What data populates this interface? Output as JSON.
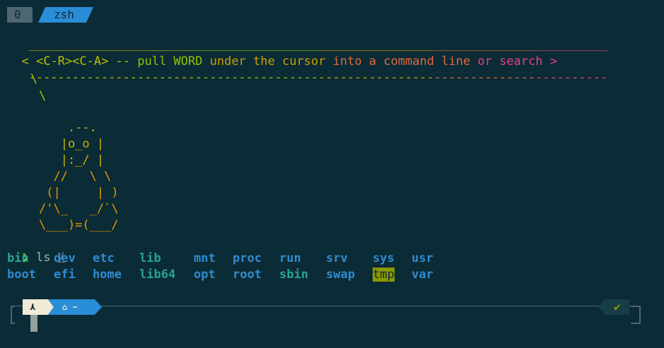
{
  "tmux": {
    "window_index": "0",
    "window_name": "zsh"
  },
  "cowsay": {
    "top_rule": "____________________________________________________________________________________",
    "message_parts": [
      {
        "text": "< <C-R><C-A> -- ",
        "color": "#b5c100"
      },
      {
        "text": "pull WORD ",
        "color": "#93c200"
      },
      {
        "text": "under the ",
        "color": "#c8a000"
      },
      {
        "text": "cursor ",
        "color": "#c8a000"
      },
      {
        "text": "into a ",
        "color": "#e16a3b"
      },
      {
        "text": "command line ",
        "color": "#e16a3b"
      },
      {
        "text": "or search ",
        "color": "#e8437a"
      },
      {
        "text": ">",
        "color": "#e83ca0"
      }
    ],
    "bottom_rule": "------------------------------------------------------------------------------------",
    "tail_1": "\\",
    "tail_2": "\\",
    "tux": [
      "    .--.",
      "   |o_o |",
      "   |:_/ |",
      "  //   \\ \\",
      " (|     | )",
      "/'\\_   _/`\\",
      "\\___)=(___/"
    ]
  },
  "prompt": {
    "symbol": "❯",
    "command": "ls",
    "argument": "/"
  },
  "ls_output": {
    "row1": [
      "bin",
      "dev",
      "etc",
      "lib",
      "mnt",
      "proc",
      "run",
      "srv",
      "sys",
      "usr"
    ],
    "row2": [
      "boot",
      "efi",
      "home",
      "lib64",
      "opt",
      "root",
      "sbin",
      "swap",
      "tmp",
      "var"
    ]
  },
  "statusline": {
    "os_icon": "arch-linux-icon",
    "os_glyph": "⋏",
    "dir_icon": "home-icon",
    "dir_glyph": "⌂",
    "dir_text": "~",
    "status_glyph": "✔",
    "status_icon": "checkmark-icon"
  }
}
